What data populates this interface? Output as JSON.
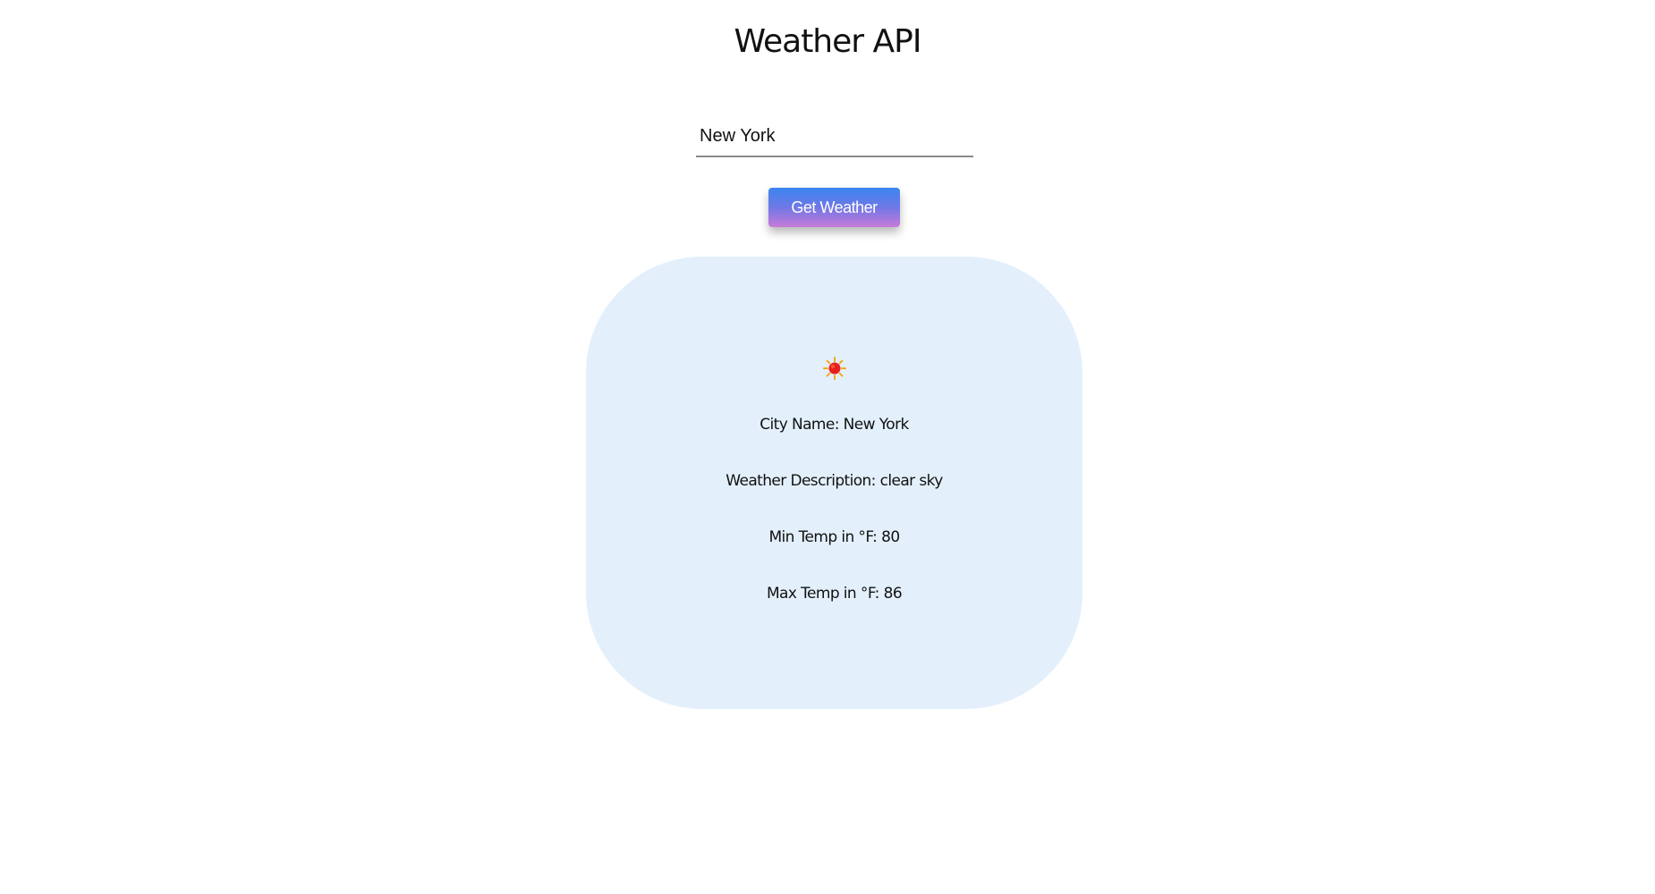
{
  "header": {
    "title": "Weather API"
  },
  "search": {
    "value": "New York",
    "button_label": "Get Weather"
  },
  "result": {
    "icon": "sun-icon",
    "city_line": "City Name: New York",
    "description_line": "Weather Description: clear sky",
    "min_temp_line": "Min Temp in °F: 80",
    "max_temp_line": "Max Temp in °F: 86"
  },
  "colors": {
    "card_background": "#e3f0fc",
    "button_gradient_top": "#3a86f0",
    "button_gradient_bottom": "#c77ad8",
    "sun_core": "#e8201c",
    "sun_rays": "#f5a81a"
  }
}
